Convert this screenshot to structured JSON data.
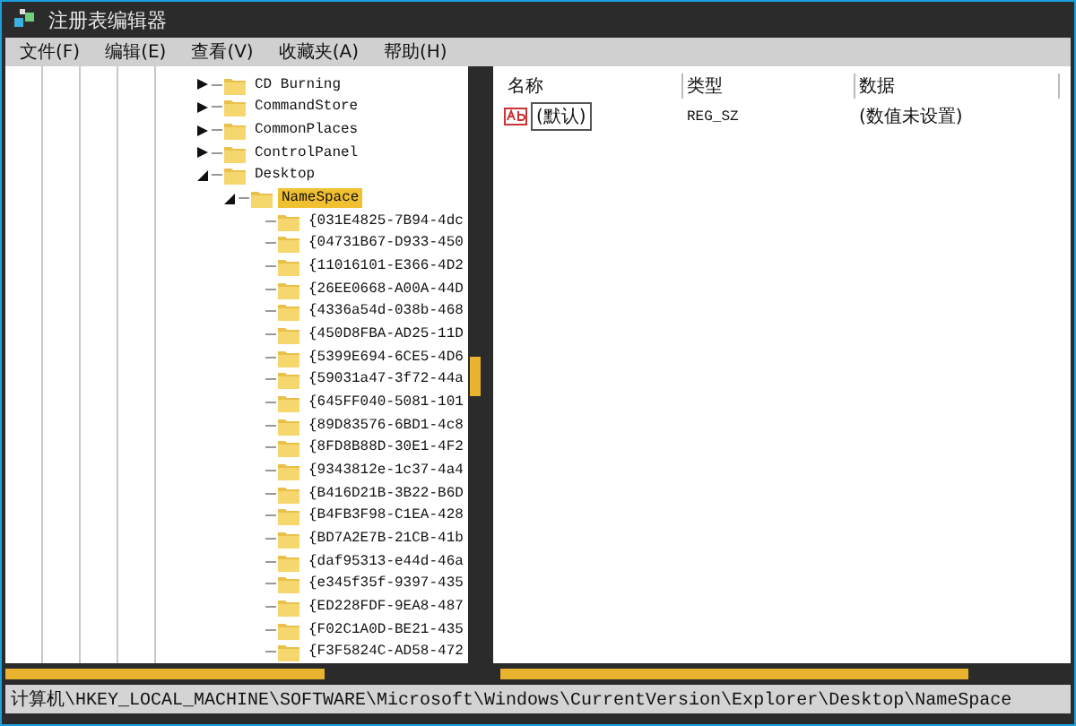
{
  "window": {
    "title": "注册表编辑器"
  },
  "menu": [
    "文件(F)",
    "编辑(E)",
    "查看(V)",
    "收藏夹(A)",
    "帮助(H)"
  ],
  "tree": [
    {
      "label": "CD Burning",
      "expanded": false,
      "selected": false
    },
    {
      "label": "CommandStore",
      "expanded": false,
      "selected": false
    },
    {
      "label": "CommonPlaces",
      "expanded": false,
      "selected": false
    },
    {
      "label": "ControlPanel",
      "expanded": false,
      "selected": false
    },
    {
      "label": "Desktop",
      "expanded": true,
      "selected": false,
      "children": [
        {
          "label": "NameSpace",
          "expanded": true,
          "selected": true,
          "children": [
            {
              "label": "{031E4825-7B94-4dc",
              "selected": false
            },
            {
              "label": "{04731B67-D933-450",
              "selected": false
            },
            {
              "label": "{11016101-E366-4D2",
              "selected": false
            },
            {
              "label": "{26EE0668-A00A-44D",
              "selected": false
            },
            {
              "label": "{4336a54d-038b-468",
              "selected": false
            },
            {
              "label": "{450D8FBA-AD25-11D",
              "selected": false
            },
            {
              "label": "{5399E694-6CE5-4D6",
              "selected": false
            },
            {
              "label": "{59031a47-3f72-44a",
              "selected": false
            },
            {
              "label": "{645FF040-5081-101",
              "selected": false
            },
            {
              "label": "{89D83576-6BD1-4c8",
              "selected": false
            },
            {
              "label": "{8FD8B88D-30E1-4F2",
              "selected": false
            },
            {
              "label": "{9343812e-1c37-4a4",
              "selected": false
            },
            {
              "label": "{B416D21B-3B22-B6D",
              "selected": false
            },
            {
              "label": "{B4FB3F98-C1EA-428",
              "selected": false
            },
            {
              "label": "{BD7A2E7B-21CB-41b",
              "selected": false
            },
            {
              "label": "{daf95313-e44d-46a",
              "selected": false
            },
            {
              "label": "{e345f35f-9397-435",
              "selected": false
            },
            {
              "label": "{ED228FDF-9EA8-487",
              "selected": false
            },
            {
              "label": "{F02C1A0D-BE21-435",
              "selected": false
            },
            {
              "label": "{F3F5824C-AD58-472",
              "selected": false
            }
          ]
        }
      ]
    }
  ],
  "values": {
    "columns": [
      "名称",
      "类型",
      "数据"
    ],
    "rows": [
      {
        "name": "(默认)",
        "type": "REG_SZ",
        "data": "(数值未设置)",
        "selected": true
      }
    ]
  },
  "status_bar": "计算机\\HKEY_LOCAL_MACHINE\\SOFTWARE\\Microsoft\\Windows\\CurrentVersion\\Explorer\\Desktop\\NameSpace"
}
